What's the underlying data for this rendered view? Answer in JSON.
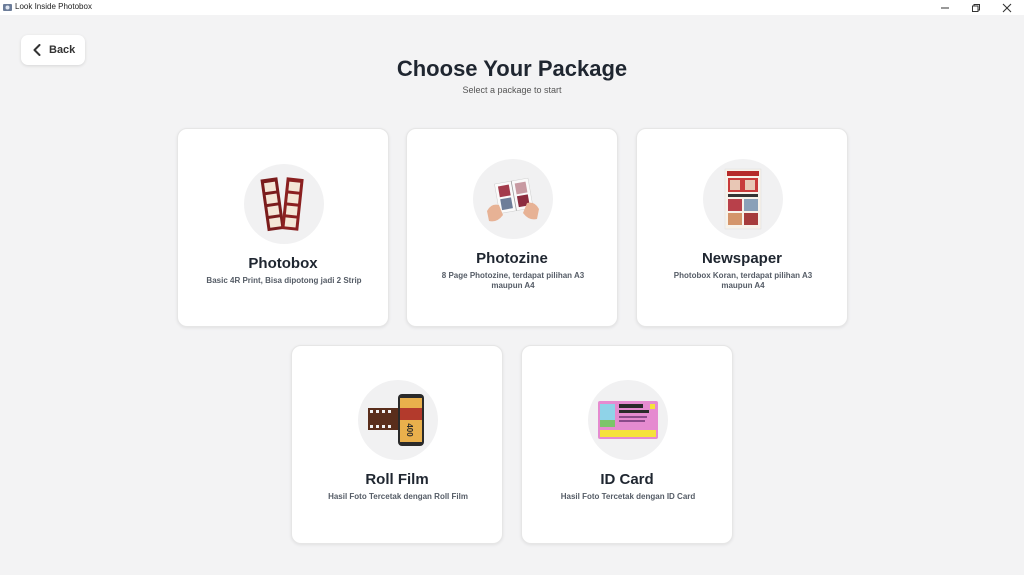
{
  "window": {
    "title": "Look Inside Photobox"
  },
  "header": {
    "back_label": "Back",
    "title": "Choose Your Package",
    "subtitle": "Select a package to start"
  },
  "packages": [
    {
      "title": "Photobox",
      "description": "Basic 4R Print, Bisa dipotong jadi 2 Strip",
      "icon": "photostrip-icon"
    },
    {
      "title": "Photozine",
      "description": "8 Page Photozine, terdapat pilihan A3 maupun A4",
      "icon": "photozine-icon"
    },
    {
      "title": "Newspaper",
      "description": "Photobox Koran, terdapat pilihan A3 maupun A4",
      "icon": "newspaper-icon"
    },
    {
      "title": "Roll Film",
      "description": "Hasil Foto Tercetak dengan Roll Film",
      "icon": "film-roll-icon"
    },
    {
      "title": "ID Card",
      "description": "Hasil Foto Tercetak dengan ID Card",
      "icon": "id-card-icon"
    }
  ],
  "colors": {
    "background": "#f3f3f4",
    "card": "#ffffff",
    "text": "#1f2630"
  }
}
